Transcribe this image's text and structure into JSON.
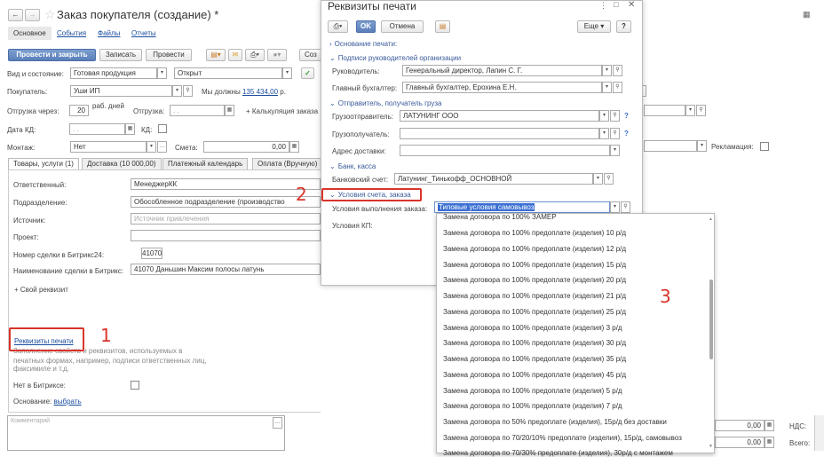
{
  "main": {
    "title": "Заказ покупателя (создание) *",
    "nav_tabs": [
      "Основное",
      "События",
      "Файлы",
      "Отчеты"
    ],
    "buttons": {
      "post_close": "Провести и закрыть",
      "save": "Записать",
      "post": "Провести",
      "create": "Соз"
    },
    "state_label": "Вид и состояние:",
    "state_value": "Готовая продукция",
    "state_status": "Открыт",
    "buyer_label": "Покупатель:",
    "buyer_value": "Уши ИП",
    "owe_text": "Мы должны",
    "owe_amount": "135 434,00",
    "owe_currency": "р.",
    "ship_label": "Отгрузка через:",
    "ship_days": "20",
    "ship_days_unit": "раб. дней",
    "ship_date_label": "Отгрузка:",
    "ship_date_value": " .  .",
    "calc_label": "+ Калькуляция заказа",
    "kd_date_label": "Дата КД:",
    "kd_date_value": " .  .",
    "kd_label": "КД:",
    "mount_label": "Монтаж:",
    "mount_value": "Нет",
    "estimate_label": "Смета:",
    "estimate_value": "0,00",
    "tabs": [
      "Товары, услуги (1)",
      "Доставка (10 000,00)",
      "Платежный календарь",
      "Оплата (Вручную)"
    ],
    "fields": {
      "responsible_label": "Ответственный:",
      "responsible_value": "МенеджерКК",
      "division_label": "Подразделение:",
      "division_value": "Обособленное подразделение (производство",
      "source_label": "Источник:",
      "source_placeholder": "Источник привлечения",
      "project_label": "Проект:",
      "bitrix_num_label": "Номер сделки в Битрикс24:",
      "bitrix_num_value": "41070",
      "bitrix_name_label": "Наименование сделки в Битрикс:",
      "bitrix_name_value": "41070 Даньшин Максим полосы латунь",
      "own_attr": "+ Свой реквизит"
    },
    "print_link": "Реквизиты печати",
    "print_hint_1": "Заполнение свойств и реквизитов, используемых в",
    "print_hint_2": "печатных формах, например, подписи ответственных лиц,",
    "print_hint_3": "факсимиле и т.д.",
    "not_bitrix_label": "Нет в Битриксе:",
    "basis_label": "Основание:",
    "basis_link": "выбрать",
    "comment_placeholder": "Комментарий",
    "advertising_label": "Рекламация:",
    "total_1": "0,00",
    "total_2": "0,00",
    "vat_label": "НДС:",
    "total_label": "Всего:"
  },
  "dialog": {
    "title": "Реквизиты печати",
    "ok": "OK",
    "cancel": "Отмена",
    "more": "Еще",
    "help": "?",
    "group_print_basis": "Основание печати:",
    "group_signatures": "Подписи руководителей организации",
    "head_label": "Руководитель:",
    "head_value": "Генеральный директор, Лапин С. Г.",
    "accountant_label": "Главный бухгалтер:",
    "accountant_value": "Главный бухгалтер, Ерохина Е.Н.",
    "group_sender": "Отправитель, получатель груза",
    "shipper_label": "Грузоотправитель:",
    "shipper_value": "ЛАТУНИНГ ООО",
    "consignee_label": "Грузополучатель:",
    "delivery_label": "Адрес доставки:",
    "group_bank": "Банк, касса",
    "bank_label": "Банковский счет:",
    "bank_value": "Латунинг_Тинькофф_ОСНОВНОЙ",
    "group_terms": "Условия счета, заказа",
    "terms_label": "Условия выполнения заказа:",
    "terms_value": "Типовые условия самовывоз",
    "kp_label": "Условия КП:"
  },
  "dropdown": {
    "items": [
      "Замена договора по 100% ЗАМЕР",
      "Замена договора по 100% предоплате (изделия) 10 р/д",
      "Замена договора по 100% предоплате (изделия) 12 р/д",
      "Замена договора по 100% предоплате (изделия) 15 р/д",
      "Замена договора по 100% предоплате (изделия) 20 р/д",
      "Замена договора по 100% предоплате (изделия) 21 р/д",
      "Замена договора по 100% предоплате (изделия) 25 р/д",
      "Замена договора по 100% предоплате (изделия) 3 р/д",
      "Замена договора по 100% предоплате (изделия) 30 р/д",
      "Замена договора по 100% предоплате (изделия) 35 р/д",
      "Замена договора по 100% предоплате (изделия) 45 р/д",
      "Замена договора по 100% предоплате (изделия) 5 р/д",
      "Замена договора по 100% предоплате (изделия) 7 р/д",
      "Замена договора по 50% предоплате (изделия), 15р/д без доставки",
      "Замена договора по 70/20/10% предоплате (изделия), 15р/д, самовывоз",
      "Замена договора по 70/30% предоплате (изделия), 30р/д с монтажем"
    ]
  },
  "annotations": {
    "n1": "1",
    "n2": "2",
    "n3": "3"
  },
  "colors": {
    "accent_red": "#d9342b",
    "link_blue": "#1a4d9e",
    "selection": "#3b6fd4"
  }
}
